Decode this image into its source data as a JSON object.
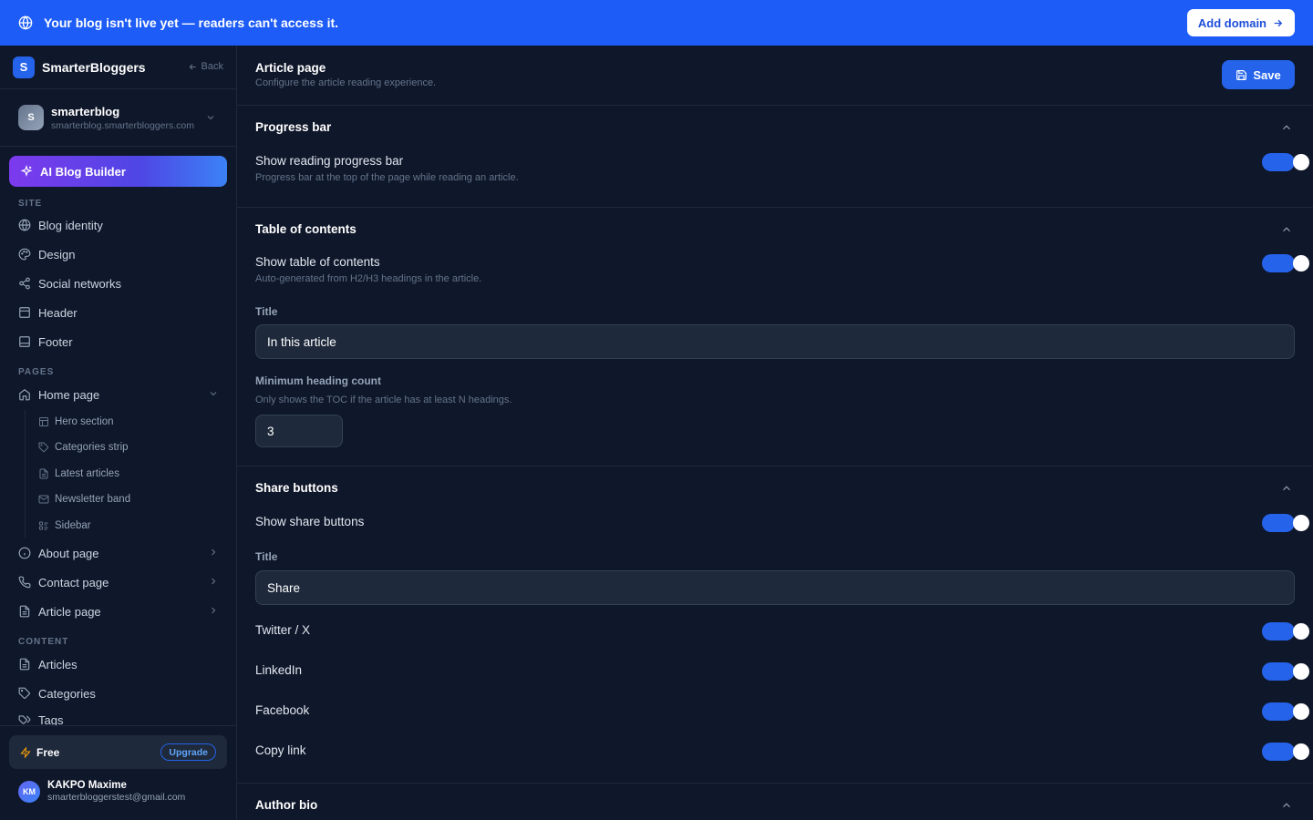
{
  "banner": {
    "message": "Your blog isn't live yet — readers can't access it.",
    "action_label": "Add domain"
  },
  "sidebar": {
    "brand_name": "SmarterBloggers",
    "brand_initial": "S",
    "back_label": "Back",
    "blog": {
      "initial": "S",
      "name": "smarterblog",
      "url": "smarterblog.smarterbloggers.com"
    },
    "ai_builder_label": "AI Blog Builder",
    "site_label": "SITE",
    "site_items": [
      "Blog identity",
      "Design",
      "Social networks",
      "Header",
      "Footer"
    ],
    "pages_label": "PAGES",
    "home_page_label": "Home page",
    "home_sub_items": [
      "Hero section",
      "Categories strip",
      "Latest articles",
      "Newsletter band",
      "Sidebar"
    ],
    "about_page_label": "About page",
    "contact_page_label": "Contact page",
    "article_page_label": "Article page",
    "content_label": "CONTENT",
    "content_items": [
      "Articles",
      "Categories",
      "Tags"
    ],
    "plan": {
      "name": "Free",
      "upgrade_label": "Upgrade"
    },
    "user": {
      "initials": "KM",
      "name": "KAKPO Maxime",
      "email": "smarterbloggerstest@gmail.com"
    }
  },
  "main": {
    "title": "Article page",
    "subtitle": "Configure the article reading experience.",
    "save_label": "Save",
    "progress_bar": {
      "heading": "Progress bar",
      "toggle_title": "Show reading progress bar",
      "toggle_desc": "Progress bar at the top of the page while reading an article.",
      "enabled": true
    },
    "toc": {
      "heading": "Table of contents",
      "toggle_title": "Show table of contents",
      "toggle_desc": "Auto-generated from H2/H3 headings in the article.",
      "enabled": true,
      "title_label": "Title",
      "title_value": "In this article",
      "min_label": "Minimum heading count",
      "min_help": "Only shows the TOC if the article has at least N headings.",
      "min_value": "3"
    },
    "share": {
      "heading": "Share buttons",
      "toggle_title": "Show share buttons",
      "enabled": true,
      "title_label": "Title",
      "title_value": "Share",
      "networks": [
        "Twitter / X",
        "LinkedIn",
        "Facebook",
        "Copy link"
      ]
    },
    "author_bio": {
      "heading": "Author bio"
    }
  },
  "colors": {
    "accent": "#2563eb",
    "banner": "#1d5cf6",
    "background": "#0f172a"
  }
}
